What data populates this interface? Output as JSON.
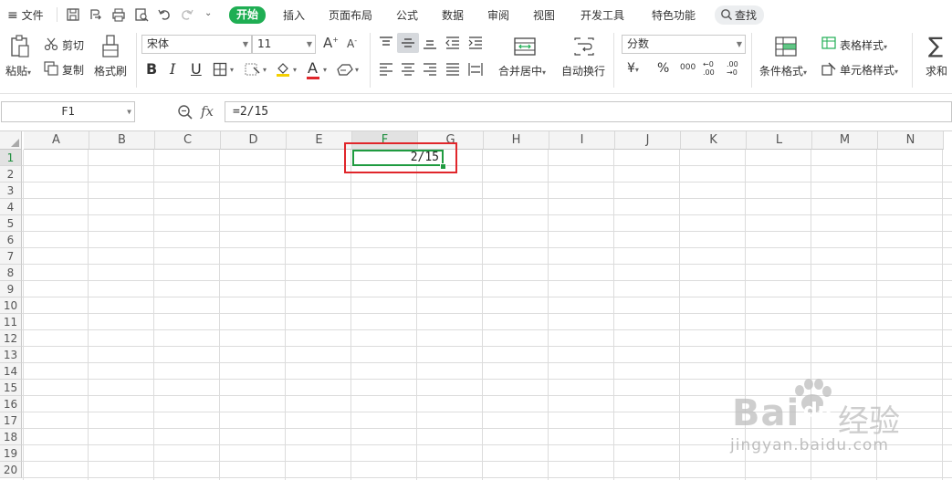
{
  "menubar": {
    "file_label": "文件",
    "tabs": [
      "开始",
      "插入",
      "页面布局",
      "公式",
      "数据",
      "审阅",
      "视图",
      "开发工具",
      "特色功能"
    ],
    "search_label": "查找"
  },
  "ribbon": {
    "paste_label": "粘贴",
    "cut_label": "剪切",
    "copy_label": "复制",
    "format_painter_label": "格式刷",
    "font_name": "宋体",
    "font_size": "11",
    "merge_center_label": "合并居中",
    "wrap_text_label": "自动换行",
    "number_format": "分数",
    "currency_symbol": "¥",
    "percent_symbol": "%",
    "thousands_symbol": "000",
    "increase_decimal": "←0 .00",
    "decrease_decimal": ".00 →0",
    "conditional_format_label": "条件格式",
    "table_style_label": "表格样式",
    "cell_style_label": "单元格样式",
    "sum_label": "求和",
    "accent_color": "#1fae53",
    "font_color": "#e0262b",
    "highlight_color": "#f5d000"
  },
  "formula_bar": {
    "name_box": "F1",
    "fx_label": "fx",
    "formula": "=2/15"
  },
  "grid": {
    "columns": [
      "A",
      "B",
      "C",
      "D",
      "E",
      "F",
      "G",
      "H",
      "I",
      "J",
      "K",
      "L",
      "M",
      "N"
    ],
    "rows": [
      "1",
      "2",
      "3",
      "4",
      "5",
      "6",
      "7",
      "8",
      "9",
      "10",
      "11",
      "12",
      "13",
      "14",
      "15",
      "16",
      "17",
      "18",
      "19",
      "20"
    ],
    "selected_cell": "F1",
    "cell_f1_value": "2/15",
    "selection_color": "#1f9b40",
    "highlight_box_color": "#e0262b"
  },
  "watermark": {
    "brand": "Bai",
    "brand2": "du",
    "title": "经验",
    "url": "jingyan.baidu.com"
  }
}
